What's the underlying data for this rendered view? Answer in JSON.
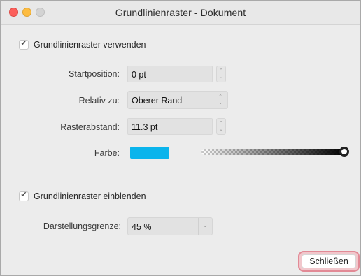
{
  "window": {
    "title": "Grundlinienraster - Dokument"
  },
  "use_grid": {
    "checked": true,
    "label": "Grundlinienraster verwenden"
  },
  "fields": {
    "start_position": {
      "label": "Startposition:",
      "value": "0 pt"
    },
    "relative_to": {
      "label": "Relativ zu:",
      "value": "Oberer Rand"
    },
    "grid_spacing": {
      "label": "Rasterabstand:",
      "value": "11.3 pt"
    },
    "color": {
      "label": "Farbe:",
      "swatch_color": "#0ab4ec",
      "opacity": 1.0
    }
  },
  "show_grid": {
    "checked": true,
    "label": "Grundlinienraster einblenden"
  },
  "display_limit": {
    "label": "Darstellungsgrenze:",
    "value": "45 %"
  },
  "buttons": {
    "close_label": "Schließen"
  },
  "icons": {
    "checkmark": "✔",
    "stepper_up": "⌃",
    "stepper_down": "⌄",
    "chevron_down": "⌄"
  },
  "colors": {
    "focus_ring": "#e28a96",
    "traffic_close": "#fc605c",
    "traffic_minimize": "#fdbc40",
    "traffic_zoom_disabled": "#d3d3d3"
  }
}
